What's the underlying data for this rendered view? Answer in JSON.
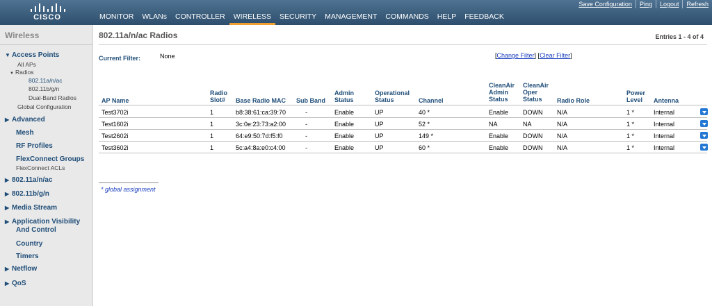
{
  "header": {
    "brand": "CISCO",
    "top_links": [
      "Save Configuration",
      "Ping",
      "Logout",
      "Refresh"
    ],
    "nav": [
      "MONITOR",
      "WLANs",
      "CONTROLLER",
      "WIRELESS",
      "SECURITY",
      "MANAGEMENT",
      "COMMANDS",
      "HELP",
      "FEEDBACK"
    ],
    "active_nav": "WIRELESS"
  },
  "sidebar": {
    "title": "Wireless",
    "access_points": "Access Points",
    "all_aps": "All APs",
    "radios": "Radios",
    "radio_items": [
      "802.11a/n/ac",
      "802.11b/g/n",
      "Dual-Band Radios"
    ],
    "global_config": "Global Configuration",
    "advanced": "Advanced",
    "mesh": "Mesh",
    "rf_profiles": "RF Profiles",
    "flexconnect_groups": "FlexConnect Groups",
    "flexconnect_acls": "FlexConnect ACLs",
    "band_a": "802.11a/n/ac",
    "band_b": "802.11b/g/n",
    "media_stream": "Media Stream",
    "avc_line1": "Application Visibility",
    "avc_line2": "And Control",
    "country": "Country",
    "timers": "Timers",
    "netflow": "Netflow",
    "qos": "QoS"
  },
  "page": {
    "title": "802.11a/n/ac Radios",
    "entries": "Entries 1 - 4 of 4",
    "filter_label": "Current Filter:",
    "filter_value": "None",
    "change_filter": "Change Filter",
    "clear_filter": "Clear Filter",
    "footnote": "* global assignment"
  },
  "table": {
    "headers": {
      "ap_name": "AP Name",
      "slot_1": "Radio",
      "slot_2": "Slot#",
      "mac": "Base Radio MAC",
      "subband": "Sub Band",
      "admin_1": "Admin",
      "admin_2": "Status",
      "oper_1": "Operational",
      "oper_2": "Status",
      "channel": "Channel",
      "ca_admin_1": "CleanAir",
      "ca_admin_2": "Admin",
      "ca_admin_3": "Status",
      "ca_oper_1": "CleanAir",
      "ca_oper_2": "Oper",
      "ca_oper_3": "Status",
      "role": "Radio Role",
      "power_1": "Power",
      "power_2": "Level",
      "antenna": "Antenna"
    },
    "rows": [
      {
        "ap": "Test3702i",
        "slot": "1",
        "mac": "b8:38:61:ca:39:70",
        "sub": "-",
        "admin": "Enable",
        "oper": "UP",
        "chan": "40 *",
        "ca_admin": "Enable",
        "ca_oper": "DOWN",
        "role": "N/A",
        "power": "1 *",
        "antenna": "Internal"
      },
      {
        "ap": "Test1602i",
        "slot": "1",
        "mac": "3c:0e:23:73:a2:00",
        "sub": "-",
        "admin": "Enable",
        "oper": "UP",
        "chan": "52 *",
        "ca_admin": "NA",
        "ca_oper": "NA",
        "role": "N/A",
        "power": "1 *",
        "antenna": "Internal"
      },
      {
        "ap": "Test2602i",
        "slot": "1",
        "mac": "64:e9:50:7d:f5:f0",
        "sub": "-",
        "admin": "Enable",
        "oper": "UP",
        "chan": "149 *",
        "ca_admin": "Enable",
        "ca_oper": "DOWN",
        "role": "N/A",
        "power": "1 *",
        "antenna": "Internal"
      },
      {
        "ap": "Test3602i",
        "slot": "1",
        "mac": "5c:a4:8a:e0:c4:00",
        "sub": "-",
        "admin": "Enable",
        "oper": "UP",
        "chan": "60 *",
        "ca_admin": "Enable",
        "ca_oper": "DOWN",
        "role": "N/A",
        "power": "1 *",
        "antenna": "Internal"
      }
    ]
  },
  "colors": {
    "header_top": "#4f7393",
    "header_bottom": "#2e4e6c",
    "active_tab_underline": "#f0a030",
    "sidebar_link": "#1f4d78",
    "dropdown_button": "#2478d4"
  }
}
